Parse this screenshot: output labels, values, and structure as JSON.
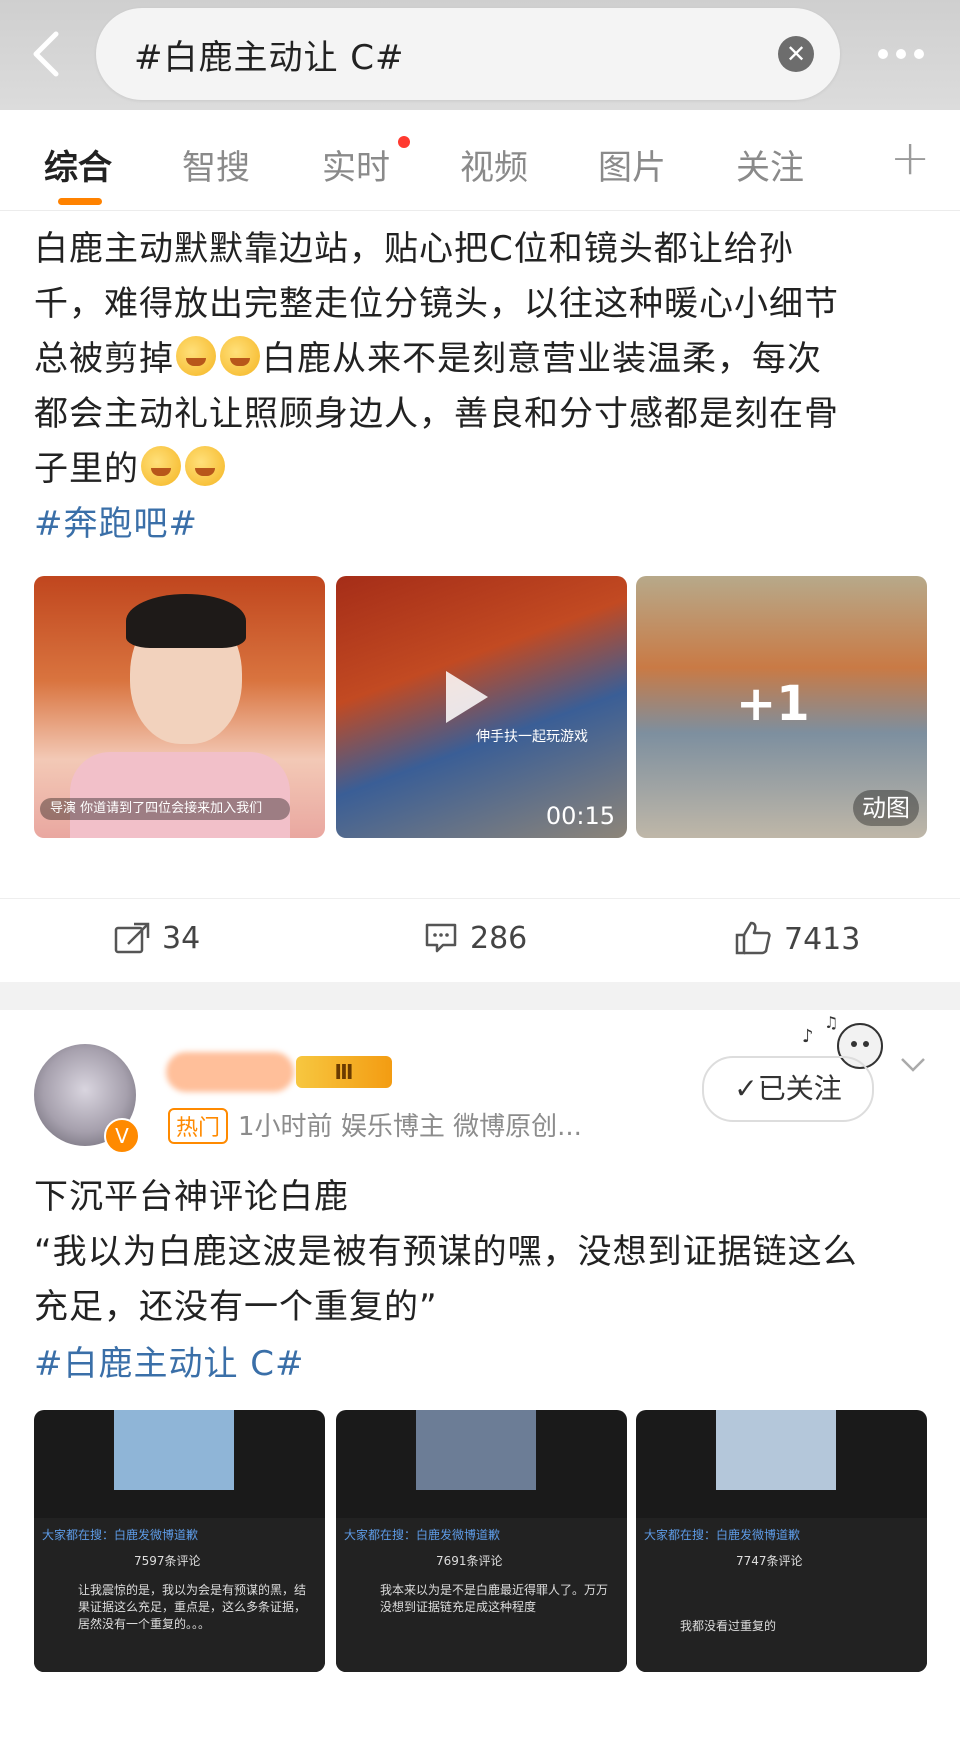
{
  "search": {
    "query": "#白鹿主动让 C#"
  },
  "tabs": [
    {
      "label": "综合"
    },
    {
      "label": "智搜"
    },
    {
      "label": "实时"
    },
    {
      "label": "视频"
    },
    {
      "label": "图片"
    },
    {
      "label": "关注"
    }
  ],
  "post1": {
    "text_lines": [
      "白鹿主动默默靠边站，贴心把C位和镜头都让给孙",
      "千，难得放出完整走位分镜头，以往这种暖心小细节",
      "总被剪掉",
      "白鹿从来不是刻意营业装温柔，每次",
      "都会主动礼让照顾身边人，善良和分寸感都是刻在骨",
      "子里的"
    ],
    "hashtag": "#奔跑吧#",
    "images": {
      "img1_caption": "导演  你道请到了四位会接来加入我们",
      "img2_overlay": "伸手扶一起玩游戏",
      "video_duration": "00:15",
      "more_count": "+1",
      "gif_badge": "动图"
    },
    "actions": {
      "repost": "34",
      "comment": "286",
      "like": "7413"
    }
  },
  "post2": {
    "hot_label": "热门",
    "meta": "1小时前  娱乐博主 微博原创...",
    "level_badge": "Ⅲ",
    "follow_label": "已关注",
    "text_lines": [
      "下沉平台神评论白鹿",
      "“我以为白鹿这波是被有预谋的嘿，没想到证据链这么",
      "充足，还没有一个重复的”"
    ],
    "hashtag": "#白鹿主动让 C#",
    "screens": [
      {
        "title": "大家都在搜：白鹿发微博道歉",
        "count": "7597条评论",
        "comment": "让我震惊的是，我以为会是有预谋的黑，结果证据这么充足，重点是，这么多条证据，居然没有一个重复的。。。"
      },
      {
        "title": "大家都在搜：白鹿发微博道歉",
        "count": "7691条评论",
        "comment": "我本来以为是不是白鹿最近得罪人了。万万没想到证据链充足成这种程度"
      },
      {
        "title": "大家都在搜：白鹿发微博道歉",
        "count": "7747条评论",
        "comment": "我都没看过重复的"
      }
    ]
  },
  "colors": {
    "accent": "#ff8200",
    "link": "#3a6fa8",
    "hot": "#ff8a00"
  }
}
